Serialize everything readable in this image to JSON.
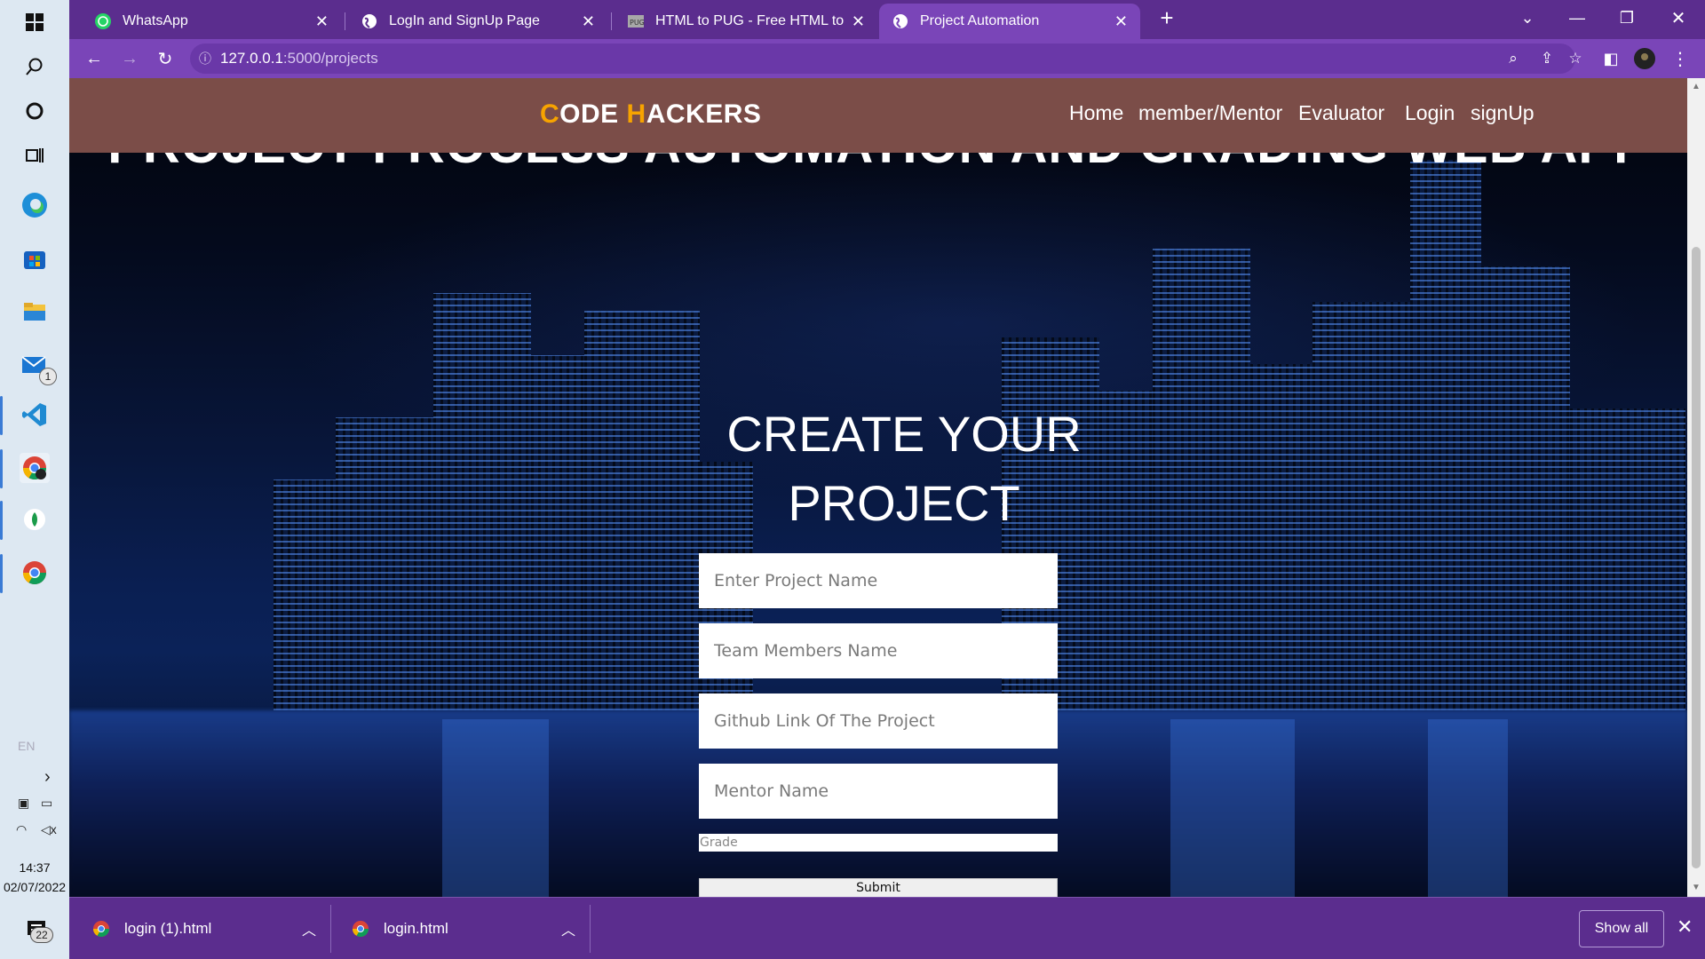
{
  "taskbar": {
    "clock_time": "14:37",
    "clock_date": "02/07/2022",
    "mail_badge": "1",
    "notification_badge": "22",
    "language": "EN"
  },
  "browser": {
    "tabs": [
      {
        "title": "WhatsApp",
        "icon": "whatsapp-icon",
        "active": false
      },
      {
        "title": "LogIn and SignUp Page",
        "icon": "globe-icon",
        "active": false
      },
      {
        "title": "HTML to PUG - Free HTML to PUG",
        "icon": "pug-icon",
        "active": false
      },
      {
        "title": "Project Automation",
        "icon": "globe-icon",
        "active": true
      }
    ],
    "url_host": "127.0.0.1",
    "url_path": ":5000/projects"
  },
  "site": {
    "logo_first_letter": "C",
    "logo_first_rest": "ODE ",
    "logo_second_letter": "H",
    "logo_second_rest": "ACKERS",
    "nav": {
      "home": "Home",
      "member": "member/Mentor",
      "evaluator": "Evaluator",
      "login": "Login",
      "signup": "signUp"
    },
    "hero_title": "PROJECT PROCESS AUTOMATION AND GRADING WEB APP"
  },
  "form": {
    "title_line1": "CREATE YOUR",
    "title_line2": "PROJECT",
    "project_name_placeholder": "Enter Project Name",
    "team_members_placeholder": "Team Members Name",
    "github_placeholder": "Github Link Of The Project",
    "mentor_placeholder": "Mentor Name",
    "grade_placeholder": "Grade",
    "submit_label": "Submit"
  },
  "downloads": {
    "items": [
      {
        "name": "login (1).html"
      },
      {
        "name": "login.html"
      }
    ],
    "show_all_label": "Show all"
  },
  "colors": {
    "browser_frame": "#5b2d8e",
    "active_tab": "#7a45b8",
    "site_header": "#7b4d48",
    "logo_accent": "#f7a300"
  }
}
